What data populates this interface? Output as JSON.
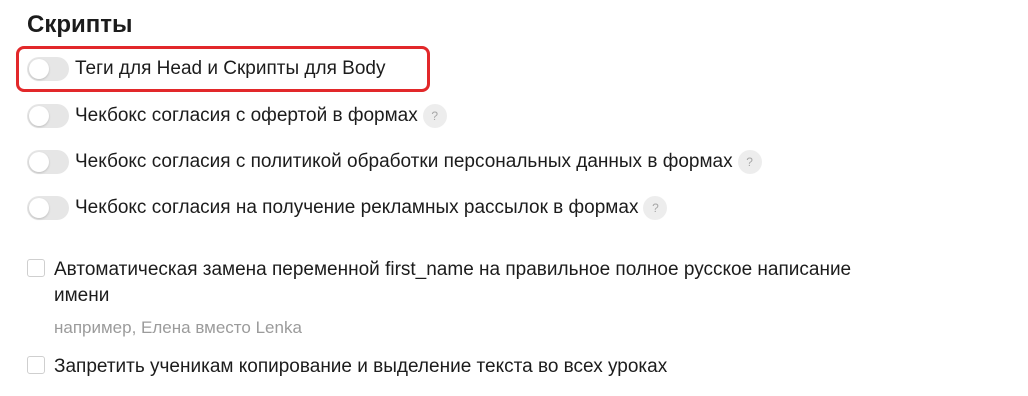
{
  "section": {
    "title": "Скрипты"
  },
  "toggles": [
    {
      "label": "Теги для Head и Скрипты для Body",
      "enabled": false,
      "has_help": false,
      "highlighted": true
    },
    {
      "label": "Чекбокс согласия с офертой в формах",
      "enabled": false,
      "has_help": true
    },
    {
      "label": "Чекбокс согласия с политикой обработки персональных данных в формах",
      "enabled": false,
      "has_help": true
    },
    {
      "label": "Чекбокс согласия на получение рекламных рассылок в формах",
      "enabled": false,
      "has_help": true
    }
  ],
  "help_glyph": "?",
  "checkboxes": [
    {
      "label": "Автоматическая замена переменной first_name на правильное полное русское написание имени",
      "hint": "например, Елена вместо Lenka",
      "checked": false
    },
    {
      "label": "Запретить ученикам копирование и выделение текста во всех уроках",
      "checked": false
    }
  ],
  "colors": {
    "highlight_border": "#e2282a",
    "toggle_off": "#e6e6e6",
    "text": "#1c1c1c",
    "hint_text": "#9b9b9b"
  }
}
